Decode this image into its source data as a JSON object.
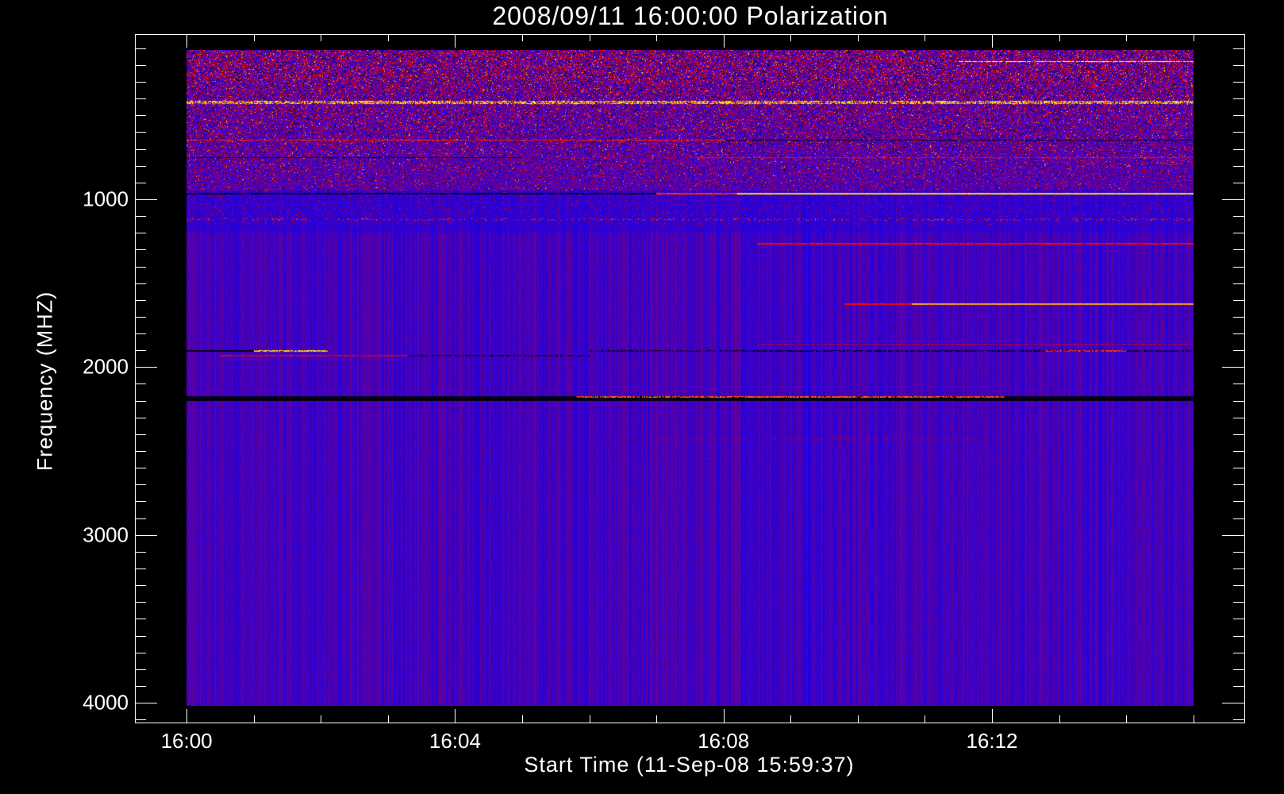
{
  "chart_data": {
    "type": "heatmap",
    "title": "2008/09/11 16:00:00 Polarization",
    "xlabel": "Start Time (11-Sep-08 15:59:37)",
    "ylabel": "Frequency (MHZ)",
    "x_units": "minutes after 16:00",
    "xlim": [
      -0.77,
      15.76
    ],
    "ylim": [
      4118,
      16
    ],
    "x_major_ticks": [
      0,
      4,
      8,
      12
    ],
    "x_tick_labels": [
      "16:00",
      "16:04",
      "16:08",
      "16:12"
    ],
    "x_minor_step": 1,
    "y_major_ticks": [
      1000,
      2000,
      3000,
      4000
    ],
    "y_tick_labels": [
      "1000",
      "2000",
      "3000",
      "4000"
    ],
    "y_minor_step": 100,
    "data_time_range": [
      0,
      15
    ],
    "data_freq_range": [
      110,
      4020
    ],
    "colormap": [
      [
        0,
        "#000000"
      ],
      [
        0.35,
        "#0000ff"
      ],
      [
        0.6,
        "#ff0000"
      ],
      [
        0.8,
        "#ffa020"
      ],
      [
        0.9,
        "#ffff00"
      ],
      [
        1,
        "#ffffff"
      ]
    ],
    "background_level": 0.38,
    "features": [
      {
        "freq": 180,
        "width": 6,
        "t0": 11.5,
        "t1": 15,
        "level": 0.95,
        "fill": 0.8
      },
      {
        "freq": 422,
        "width": 16,
        "t0": 0,
        "t1": 15,
        "level": 0.86,
        "fill": 0.55
      },
      {
        "freq": 646,
        "width": 5,
        "t0": 0,
        "t1": 8,
        "level": 0.65,
        "fill": 0.85
      },
      {
        "freq": 646,
        "width": 5,
        "t0": 8,
        "t1": 15,
        "level": 0.04,
        "fill": 0.85
      },
      {
        "freq": 752,
        "width": 5,
        "t0": 0,
        "t1": 5,
        "level": 0.05,
        "fill": 0.9
      },
      {
        "freq": 752,
        "width": 5,
        "t0": 7.5,
        "t1": 15,
        "level": 0.62,
        "fill": 0.7
      },
      {
        "freq": 966,
        "width": 11,
        "t0": 0,
        "t1": 7,
        "level": 0.04,
        "fill": 0.85
      },
      {
        "freq": 966,
        "width": 11,
        "t0": 7,
        "t1": 8.2,
        "level": 0.66,
        "fill": 0.9
      },
      {
        "freq": 966,
        "width": 11,
        "t0": 8.2,
        "t1": 15,
        "level": 0.85,
        "fill": 1
      },
      {
        "freq": 1121,
        "width": 12,
        "t0": 0,
        "t1": 15,
        "level": 0.68,
        "fill": 0.12
      },
      {
        "freq": 1267,
        "width": 10,
        "t0": 8.5,
        "t1": 15,
        "level": 0.6,
        "fill": 0.9
      },
      {
        "freq": 1626,
        "width": 11,
        "t0": 9.8,
        "t1": 10.8,
        "level": 0.6,
        "fill": 1
      },
      {
        "freq": 1626,
        "width": 11,
        "t0": 10.8,
        "t1": 15,
        "level": 0.8,
        "fill": 1
      },
      {
        "freq": 1864,
        "width": 5,
        "t0": 8.5,
        "t1": 15,
        "level": 0.55,
        "fill": 0.8
      },
      {
        "freq": 1903,
        "width": 7,
        "t0": 0,
        "t1": 1,
        "level": 0.03,
        "fill": 1
      },
      {
        "freq": 1903,
        "width": 7,
        "t0": 1,
        "t1": 2.1,
        "level": 0.86,
        "fill": 0.8
      },
      {
        "freq": 1903,
        "width": 7,
        "t0": 6,
        "t1": 15,
        "level": 0.04,
        "fill": 0.5
      },
      {
        "freq": 1903,
        "width": 7,
        "t0": 12.8,
        "t1": 14,
        "level": 0.66,
        "fill": 0.6
      },
      {
        "freq": 1932,
        "width": 8,
        "t0": 0.5,
        "t1": 3.3,
        "level": 0.55,
        "fill": 0.8
      },
      {
        "freq": 1932,
        "width": 8,
        "t0": 3.3,
        "t1": 6,
        "level": 0.04,
        "fill": 0.5
      },
      {
        "freq": 2188,
        "width": 24,
        "t0": 0,
        "t1": 15,
        "level": 0.02,
        "fill": 1
      },
      {
        "freq": 2178,
        "width": 10,
        "t0": 5.8,
        "t1": 12.2,
        "level": 0.72,
        "fill": 0.75
      },
      {
        "freq": 2427,
        "width": 5,
        "t0": 6,
        "t1": 12,
        "level": 0.5,
        "fill": 0.3
      }
    ]
  }
}
